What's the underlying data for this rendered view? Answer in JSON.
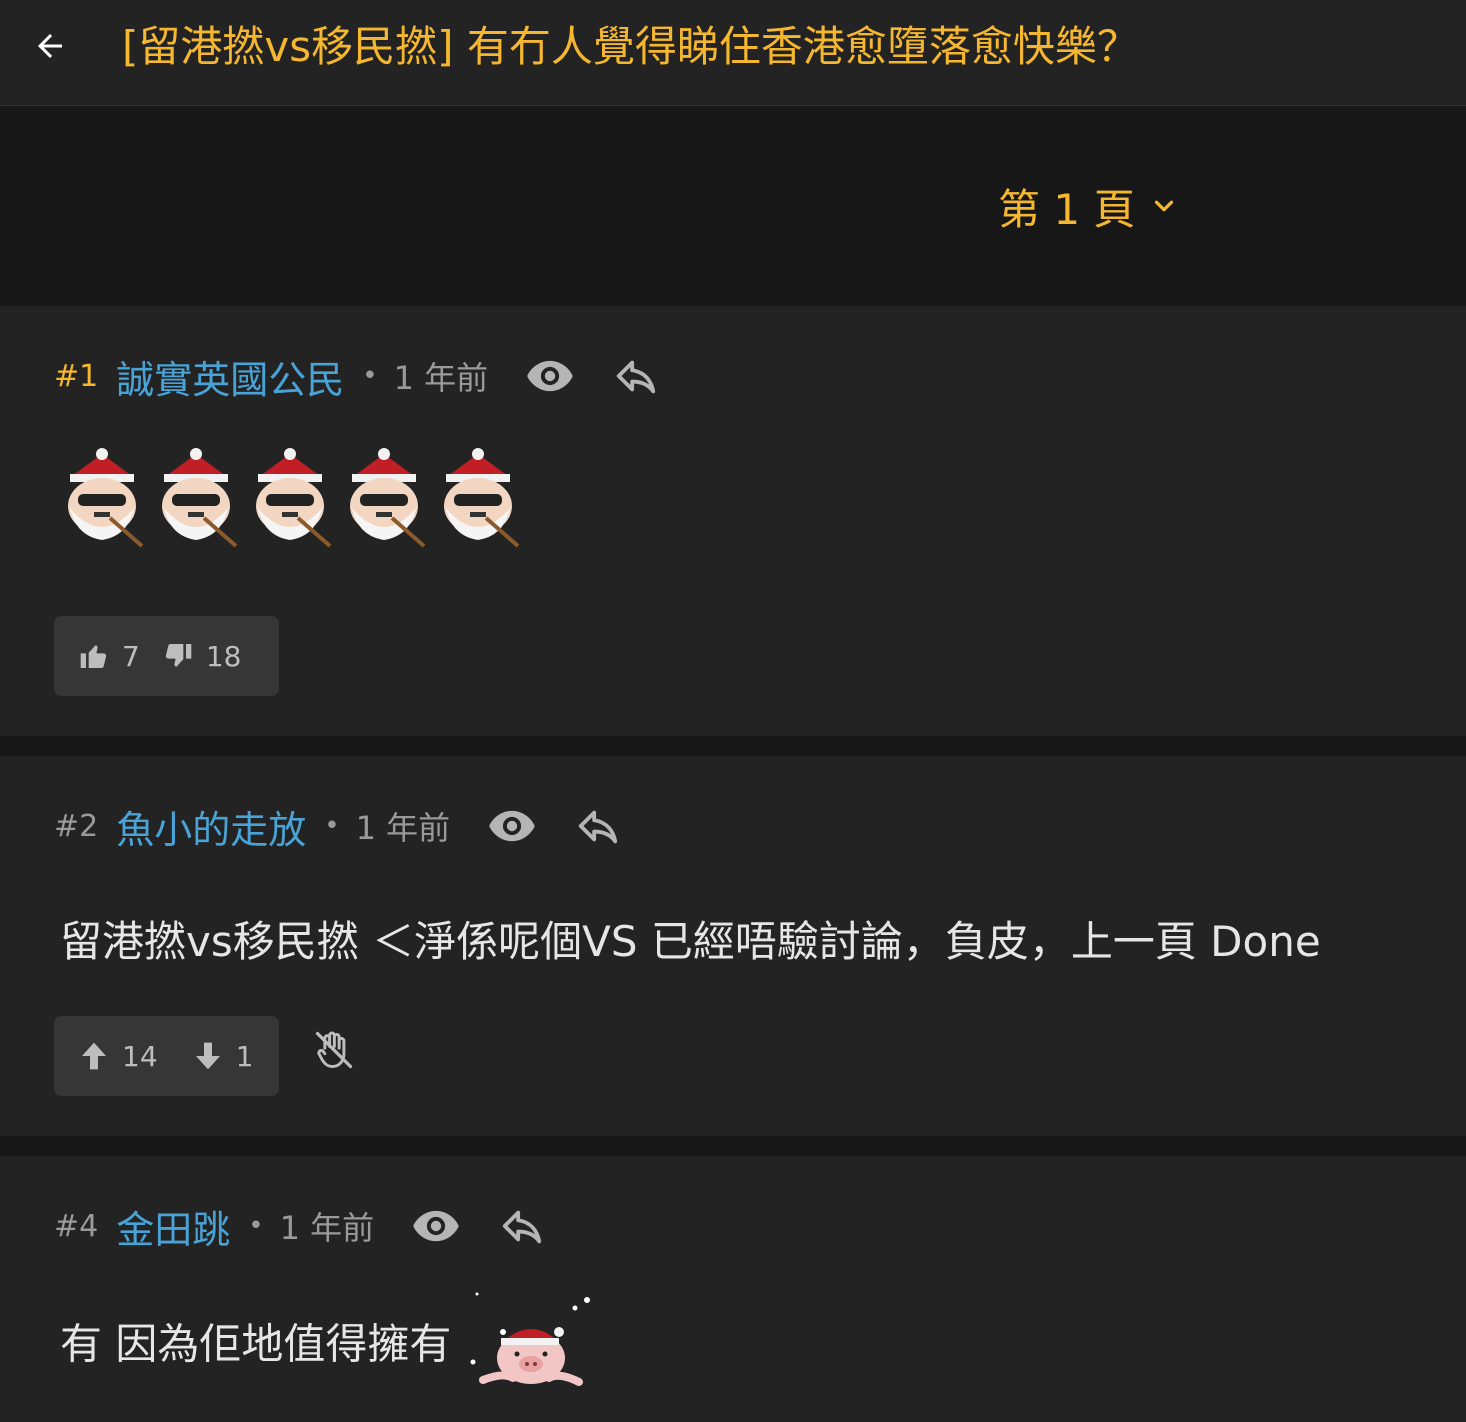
{
  "header": {
    "back_icon": "arrow-left-icon",
    "title": "[留港撚vs移民撚] 有冇人覺得睇住香港愈墮落愈快樂？",
    "title_color": "#f5b72f"
  },
  "pagination": {
    "label": "第 1 頁",
    "icon": "chevron-down-icon"
  },
  "posts": [
    {
      "number": "#1",
      "username": "誠實英國公民",
      "separator": "•",
      "time": "1 年前",
      "body": "",
      "emoji_count": 5,
      "likes": "7",
      "dislikes": "18",
      "vote_style": "thumbs"
    },
    {
      "number": "#2",
      "username": "魚小的走放",
      "separator": "•",
      "time": "1 年前",
      "body": "留港撚vs移民撚 ＜淨係呢個VS 已經唔驗討論，負皮，上一頁 Done",
      "likes": "14",
      "dislikes": "1",
      "vote_style": "arrows"
    },
    {
      "number": "#4",
      "username": "金田跳",
      "separator": "•",
      "time": "1 年前",
      "body": "有 因為佢地值得擁有"
    }
  ],
  "colors": {
    "accent": "#f5b72f",
    "username": "#4aa3d6",
    "muted": "#9a9a9a",
    "post_bg": "#232323",
    "page_bg": "#171717"
  }
}
